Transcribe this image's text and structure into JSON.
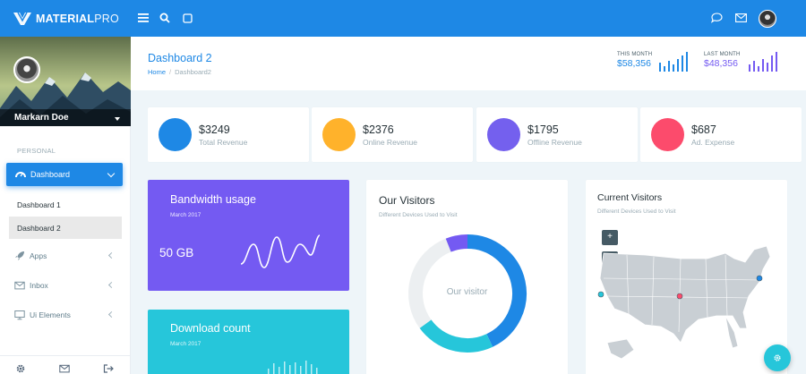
{
  "brand": {
    "bold": "MATERIAL",
    "light": "PRO"
  },
  "topbar": {
    "icons": [
      "menu-icon",
      "search-icon",
      "square-icon",
      "chat-icon",
      "mail-icon"
    ],
    "accent": "#1e88e5"
  },
  "profile": {
    "name": "Markarn Doe"
  },
  "sidebar": {
    "section_label": "PERSONAL",
    "active": {
      "label": "Dashboard"
    },
    "subitems": [
      {
        "label": "Dashboard 1"
      },
      {
        "label": "Dashboard 2"
      }
    ],
    "items": [
      {
        "label": "Apps",
        "icon": "rocket-icon"
      },
      {
        "label": "Inbox",
        "icon": "mail-icon"
      },
      {
        "label": "Ui Elements",
        "icon": "monitor-icon"
      }
    ],
    "footer_icons": [
      "gear-icon",
      "mail-icon",
      "logout-icon"
    ]
  },
  "page": {
    "title": "Dashboard 2",
    "breadcrumb_home": "Home",
    "breadcrumb_current": "Dashboard2"
  },
  "header_stats": [
    {
      "label": "THIS MONTH",
      "value": "$58,356",
      "color": "#1e88e5"
    },
    {
      "label": "LAST MONTH",
      "value": "$48,356",
      "color": "#745af2"
    }
  ],
  "stats": [
    {
      "amount": "$3249",
      "label": "Total Revenue",
      "color": "#1e88e5"
    },
    {
      "amount": "$2376",
      "label": "Online Revenue",
      "color": "#ffb22b"
    },
    {
      "amount": "$1795",
      "label": "Offline Revenue",
      "color": "#7460ee"
    },
    {
      "amount": "$687",
      "label": "Ad. Expense",
      "color": "#fc4b6c"
    }
  ],
  "bandwidth": {
    "title": "Bandwidth usage",
    "date": "March 2017",
    "value": "50 GB",
    "color": "#745af2"
  },
  "download": {
    "title": "Download count",
    "date": "March 2017",
    "color": "#26c6da"
  },
  "visitors": {
    "title": "Our Visitors",
    "subtitle": "Different Devices Used to Visit",
    "center_label": "Our visitor",
    "chart_data": {
      "type": "pie",
      "donut": true,
      "values": [
        0.43,
        0.22,
        0.29,
        0.06
      ],
      "colors": [
        "#1e88e5",
        "#26c6da",
        "#eceff1",
        "#745af2"
      ]
    }
  },
  "current": {
    "title": "Current Visitors",
    "subtitle": "Different Devices Used to Visit",
    "zoom_in": "+",
    "zoom_out": "−"
  }
}
